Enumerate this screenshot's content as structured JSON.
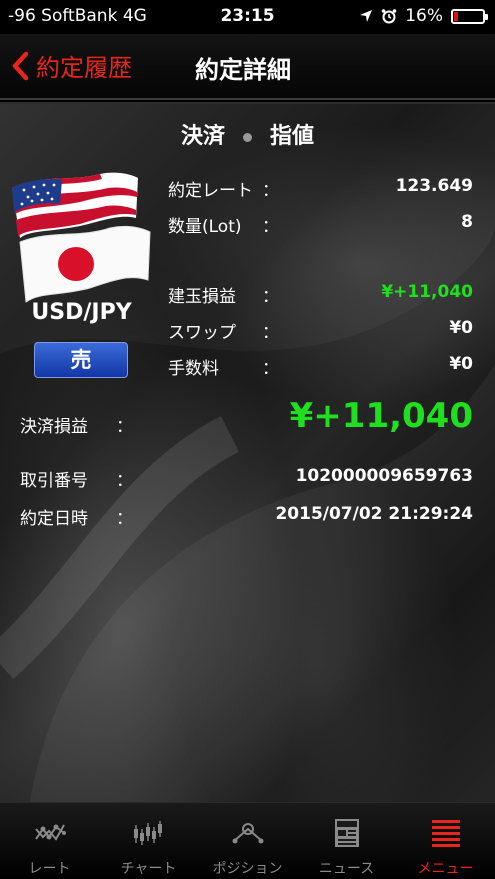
{
  "status_bar": {
    "carrier": "-96 SoftBank  4G",
    "time": "23:15",
    "battery": "16%",
    "battery_level": 0.16
  },
  "nav": {
    "back_label": "約定履歴",
    "title": "約定詳細"
  },
  "header": {
    "left": "決済",
    "right": "指値"
  },
  "instrument": {
    "pair": "USD/JPY",
    "side": "売"
  },
  "details": {
    "rate_label": "約定レート",
    "rate_value": "123.649",
    "lot_label": "数量(Lot)",
    "lot_value": "8",
    "unrealized_label": "建玉損益",
    "unrealized_value": "¥+11,040",
    "swap_label": "スワップ",
    "swap_value": "¥0",
    "fee_label": "手数料",
    "fee_value": "¥0",
    "settle_label": "決済損益",
    "settle_value": "¥+11,040",
    "trade_no_label": "取引番号",
    "trade_no_value": "102000009659763",
    "datetime_label": "約定日時",
    "datetime_value": "2015/07/02 21:29:24",
    "colon": "："
  },
  "tabs": [
    {
      "label": "レート",
      "icon": "rate-chart-icon",
      "active": false
    },
    {
      "label": "チャート",
      "icon": "candlestick-icon",
      "active": false
    },
    {
      "label": "ポジション",
      "icon": "position-icon",
      "active": false
    },
    {
      "label": "ニュース",
      "icon": "news-icon",
      "active": false
    },
    {
      "label": "メニュー",
      "icon": "menu-icon",
      "active": true
    }
  ],
  "colors": {
    "accent_red": "#e8241c",
    "profit_green": "#1ee01e",
    "sell_blue": "#1a40b8"
  }
}
